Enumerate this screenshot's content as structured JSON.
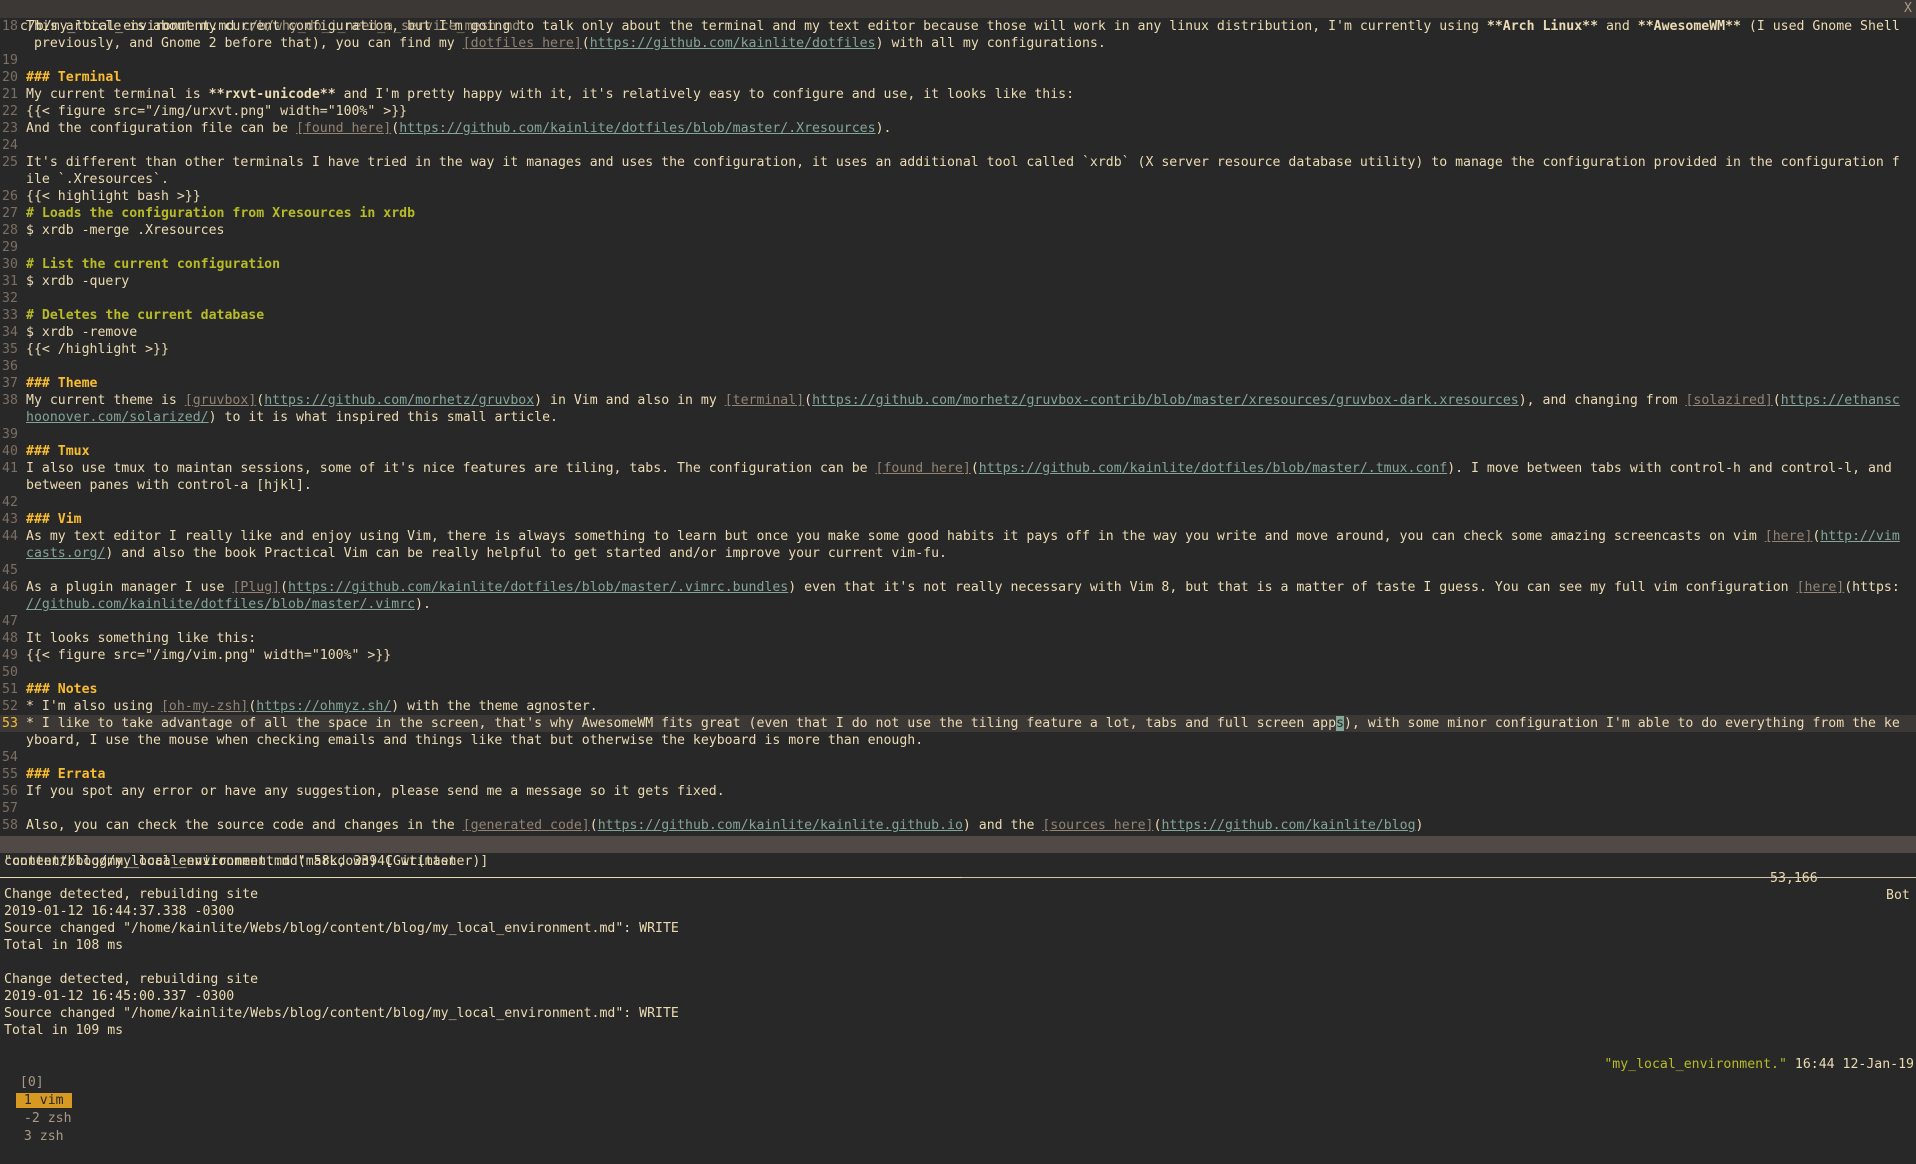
{
  "tabline": {
    "tabs": [
      {
        "label": "c/b/my_local_environment.md",
        "active": true
      },
      {
        "label": "c/b/why_do_i_need_a_service_mesh.md",
        "active": false
      }
    ],
    "close": "X"
  },
  "editor": {
    "lines": [
      {
        "n": "18",
        "s": [
          {
            "t": "This article is about my current configuration, but I'm going to talk only about the terminal and my text editor because those will work in any linux distribution, I'm currently using "
          },
          {
            "t": "**Arch Linux**",
            "k": "b"
          },
          {
            "t": " and "
          },
          {
            "t": "**AwesomeWM**",
            "k": "b"
          },
          {
            "t": " (I used Gnome Shell"
          }
        ]
      },
      {
        "n": "",
        "s": [
          {
            "t": " previously, and Gnome 2 before that), you can find my "
          },
          {
            "t": "[dotfiles here]",
            "k": "lt"
          },
          {
            "t": "("
          },
          {
            "t": "https://github.com/kainlite/dotfiles",
            "k": "u"
          },
          {
            "t": ") with all my configurations."
          }
        ]
      },
      {
        "n": "19",
        "s": []
      },
      {
        "n": "20",
        "s": [
          {
            "t": "### Terminal",
            "k": "h"
          }
        ]
      },
      {
        "n": "21",
        "s": [
          {
            "t": "My current terminal is "
          },
          {
            "t": "**rxvt-unicode**",
            "k": "b"
          },
          {
            "t": " and I'm pretty happy with it, it's relatively easy to configure and use, it looks like this:"
          }
        ]
      },
      {
        "n": "22",
        "s": [
          {
            "t": "{{< figure src=\"/img/urxvt.png\" width=\"100%\" >}}"
          }
        ]
      },
      {
        "n": "23",
        "s": [
          {
            "t": "And the configuration file can be "
          },
          {
            "t": "[found here]",
            "k": "lt"
          },
          {
            "t": "("
          },
          {
            "t": "https://github.com/kainlite/dotfiles/blob/master/.Xresources",
            "k": "u"
          },
          {
            "t": ")."
          }
        ]
      },
      {
        "n": "24",
        "s": []
      },
      {
        "n": "25",
        "s": [
          {
            "t": "It's different than other terminals I have tried in the way it manages and uses the configuration, it uses an additional tool called `xrdb` (X server resource database utility) to manage the configuration provided in the configuration f"
          }
        ]
      },
      {
        "n": "",
        "s": [
          {
            "t": "ile `.Xresources`."
          }
        ]
      },
      {
        "n": "26",
        "s": [
          {
            "t": "{{< highlight bash >}}"
          }
        ]
      },
      {
        "n": "27",
        "s": [
          {
            "t": "# Loads the configuration from Xresources in xrdb",
            "k": "c"
          }
        ]
      },
      {
        "n": "28",
        "s": [
          {
            "t": "$ xrdb -merge .Xresources"
          }
        ]
      },
      {
        "n": "29",
        "s": []
      },
      {
        "n": "30",
        "s": [
          {
            "t": "# List the current configuration",
            "k": "c"
          }
        ]
      },
      {
        "n": "31",
        "s": [
          {
            "t": "$ xrdb -query"
          }
        ]
      },
      {
        "n": "32",
        "s": []
      },
      {
        "n": "33",
        "s": [
          {
            "t": "# Deletes the current database",
            "k": "c"
          }
        ]
      },
      {
        "n": "34",
        "s": [
          {
            "t": "$ xrdb -remove"
          }
        ]
      },
      {
        "n": "35",
        "s": [
          {
            "t": "{{< /highlight >}}"
          }
        ]
      },
      {
        "n": "36",
        "s": []
      },
      {
        "n": "37",
        "s": [
          {
            "t": "### Theme",
            "k": "h"
          }
        ]
      },
      {
        "n": "38",
        "s": [
          {
            "t": "My current theme is "
          },
          {
            "t": "[gruvbox]",
            "k": "lt"
          },
          {
            "t": "("
          },
          {
            "t": "https://github.com/morhetz/gruvbox",
            "k": "u"
          },
          {
            "t": ") in Vim and also in my "
          },
          {
            "t": "[terminal]",
            "k": "lt"
          },
          {
            "t": "("
          },
          {
            "t": "https://github.com/morhetz/gruvbox-contrib/blob/master/xresources/gruvbox-dark.xresources",
            "k": "u"
          },
          {
            "t": "), and changing from "
          },
          {
            "t": "[solazired]",
            "k": "lt"
          },
          {
            "t": "("
          },
          {
            "t": "https://ethansc",
            "k": "u"
          }
        ]
      },
      {
        "n": "",
        "s": [
          {
            "t": "hoonover.com/solarized/",
            "k": "u"
          },
          {
            "t": ") to it is what inspired this small article."
          }
        ]
      },
      {
        "n": "39",
        "s": []
      },
      {
        "n": "40",
        "s": [
          {
            "t": "### Tmux",
            "k": "h"
          }
        ]
      },
      {
        "n": "41",
        "s": [
          {
            "t": "I also use tmux to maintan sessions, some of it's nice features are tiling, tabs. The configuration can be "
          },
          {
            "t": "[found here]",
            "k": "lt"
          },
          {
            "t": "("
          },
          {
            "t": "https://github.com/kainlite/dotfiles/blob/master/.tmux.conf",
            "k": "u"
          },
          {
            "t": "). I move between tabs with control-h and control-l, and"
          }
        ]
      },
      {
        "n": "",
        "s": [
          {
            "t": "between panes with control-a [hjkl]."
          }
        ]
      },
      {
        "n": "42",
        "s": []
      },
      {
        "n": "43",
        "s": [
          {
            "t": "### Vim",
            "k": "h"
          }
        ]
      },
      {
        "n": "44",
        "s": [
          {
            "t": "As my text editor I really like and enjoy using Vim, there is always something to learn but once you make some good habits it pays off in the way you write and move around, you can check some amazing screencasts on vim "
          },
          {
            "t": "[here]",
            "k": "lt"
          },
          {
            "t": "("
          },
          {
            "t": "http://vim",
            "k": "u"
          }
        ]
      },
      {
        "n": "",
        "s": [
          {
            "t": "casts.org/",
            "k": "u"
          },
          {
            "t": ") and also the book Practical Vim can be really helpful to get started and/or improve your current vim-fu."
          }
        ]
      },
      {
        "n": "45",
        "s": []
      },
      {
        "n": "46",
        "s": [
          {
            "t": "As a plugin manager I use "
          },
          {
            "t": "[Plug]",
            "k": "lt"
          },
          {
            "t": "("
          },
          {
            "t": "https://github.com/kainlite/dotfiles/blob/master/.vimrc.bundles",
            "k": "u"
          },
          {
            "t": ") even that it's not really necessary with Vim 8, but that is a matter of taste I guess. You can see my full vim configuration "
          },
          {
            "t": "[here]",
            "k": "lt"
          },
          {
            "t": "(https:"
          }
        ]
      },
      {
        "n": "",
        "s": [
          {
            "t": "//github.com/kainlite/dotfiles/blob/master/.vimrc",
            "k": "u"
          },
          {
            "t": ")."
          }
        ]
      },
      {
        "n": "47",
        "s": []
      },
      {
        "n": "48",
        "s": [
          {
            "t": "It looks something like this:"
          }
        ]
      },
      {
        "n": "49",
        "s": [
          {
            "t": "{{< figure src=\"/img/vim.png\" width=\"100%\" >}}"
          }
        ]
      },
      {
        "n": "50",
        "s": []
      },
      {
        "n": "51",
        "s": [
          {
            "t": "### Notes",
            "k": "h"
          }
        ]
      },
      {
        "n": "52",
        "s": [
          {
            "t": "* I'm also using "
          },
          {
            "t": "[oh-my-zsh]",
            "k": "lt"
          },
          {
            "t": "("
          },
          {
            "t": "https://ohmyz.sh/",
            "k": "u"
          },
          {
            "t": ") with the theme agnoster."
          }
        ]
      },
      {
        "n": "53",
        "cur": true,
        "s": [
          {
            "t": "* I like to take advantage of all the space in the screen, that's why AwesomeWM fits great (even that I do not use the tiling feature a lot, tabs and full screen app"
          },
          {
            "t": "s",
            "k": "cur"
          },
          {
            "t": "), with some minor configuration I'm able to do everything from the ke"
          }
        ]
      },
      {
        "n": "",
        "s": [
          {
            "t": "yboard, I use the mouse when checking emails and things like that but otherwise the keyboard is more than enough."
          }
        ]
      },
      {
        "n": "54",
        "s": []
      },
      {
        "n": "55",
        "s": [
          {
            "t": "### Errata",
            "k": "h"
          }
        ]
      },
      {
        "n": "56",
        "s": [
          {
            "t": "If you spot any error or have any suggestion, please send me a message so it gets fixed."
          }
        ]
      },
      {
        "n": "57",
        "s": []
      },
      {
        "n": "58",
        "s": [
          {
            "t": "Also, you can check the source code and changes in the "
          },
          {
            "t": "[generated code]",
            "k": "lt"
          },
          {
            "t": "("
          },
          {
            "t": "https://github.com/kainlite/kainlite.github.io",
            "k": "u"
          },
          {
            "t": ") and the "
          },
          {
            "t": "[sources here]",
            "k": "lt"
          },
          {
            "t": "("
          },
          {
            "t": "https://github.com/kainlite/blog",
            "k": "u"
          },
          {
            "t": ")"
          }
        ]
      }
    ]
  },
  "statusline": {
    "file": "content/blog/my_local_environment.md (markdown) [Git(master)]",
    "position": "53,166",
    "scroll": "Bot"
  },
  "message": "\"content/blog/my_local_environment.md\" 58L, 3394C written",
  "log": [
    "Change detected, rebuilding site",
    "2019-01-12 16:44:37.338 -0300",
    "Source changed \"/home/kainlite/Webs/blog/content/blog/my_local_environment.md\": WRITE",
    "Total in 108 ms",
    "",
    "Change detected, rebuilding site",
    "2019-01-12 16:45:00.337 -0300",
    "Source changed \"/home/kainlite/Webs/blog/content/blog/my_local_environment.md\": WRITE",
    "Total in 109 ms"
  ],
  "tmux": {
    "session": "[0]",
    "windows": [
      {
        "label": "1 vim",
        "active": true
      },
      {
        "label": "-2 zsh",
        "active": false
      },
      {
        "label": "3 zsh",
        "active": false
      }
    ],
    "title": "\"my_local_environment.\"",
    "clock": "16:44 12-Jan-19"
  },
  "colors": {
    "background": "#282828",
    "foreground": "#ebdbb2",
    "accent": "#fabd2f",
    "comment": "#b8bb26",
    "link": "#83a598",
    "statusbar": "#504945",
    "active_window": "#d79921"
  }
}
